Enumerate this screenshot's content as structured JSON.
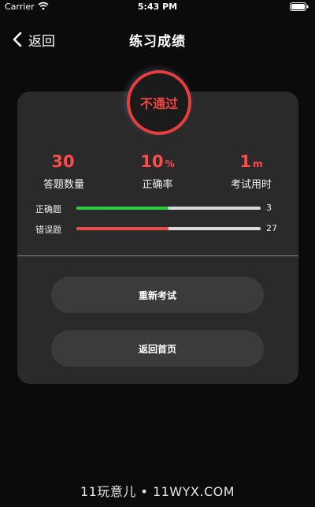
{
  "status_bar": {
    "carrier": "Carrier",
    "time": "5:43 PM"
  },
  "nav": {
    "back_label": "返回",
    "title": "练习成绩"
  },
  "result": {
    "badge_text": "不通过",
    "stats": [
      {
        "value": "30",
        "unit": "",
        "label": "答题数量"
      },
      {
        "value": "10",
        "unit": "%",
        "label": "正确率"
      },
      {
        "value": "1",
        "unit": "m",
        "label": "考试用时"
      }
    ],
    "bars": [
      {
        "label": "正确题",
        "count": "3",
        "fill_fraction": 0.5,
        "color": "#2ecc40"
      },
      {
        "label": "错误题",
        "count": "27",
        "fill_fraction": 0.5,
        "color": "#e74c4c"
      }
    ]
  },
  "actions": {
    "retry_label": "重新考试",
    "home_label": "返回首页"
  },
  "watermark": "11玩意儿 • 11WYX.COM",
  "colors": {
    "accent_red": "#ff4b4b",
    "correct_green": "#2ecc40",
    "card_bg": "#2a2a2a",
    "button_bg": "#3b3b3b"
  }
}
